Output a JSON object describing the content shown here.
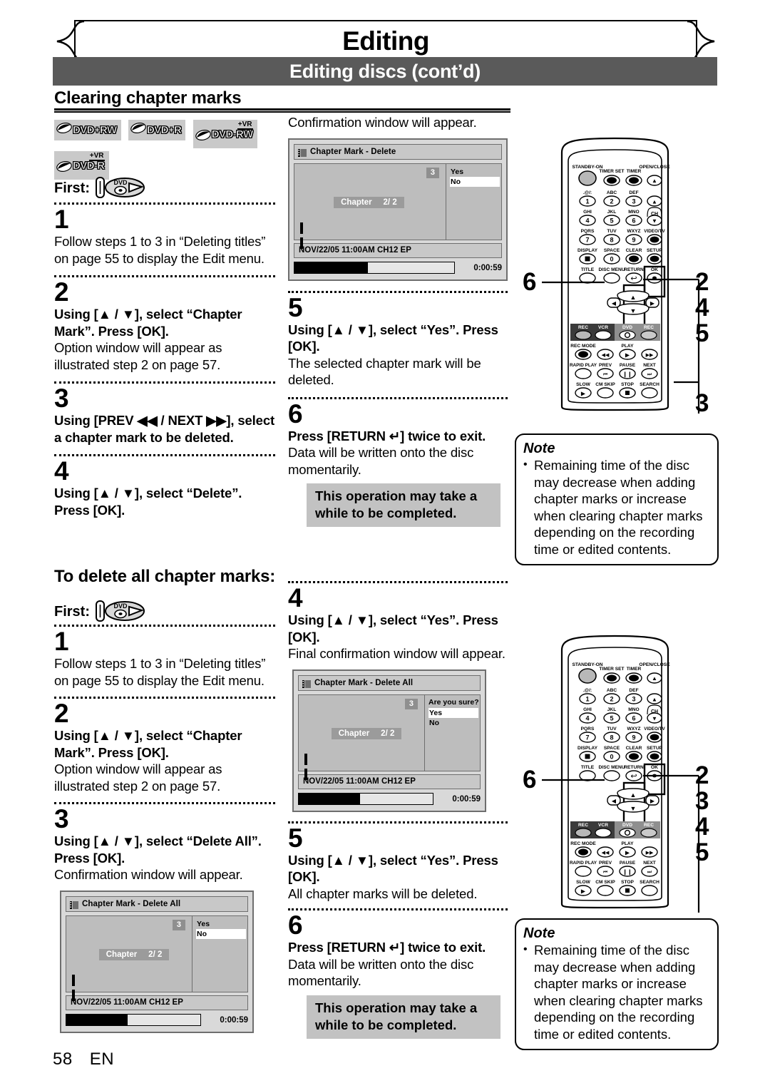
{
  "header": {
    "chapter_title": "Editing",
    "subhead": "Editing discs (cont’d)",
    "section_title": "Clearing chapter marks"
  },
  "disc_logos": [
    {
      "name": "DVD+RW",
      "vr": false
    },
    {
      "name": "DVD+R",
      "vr": false
    },
    {
      "name": "DVD-RW",
      "vr": true,
      "vr_tag": "+VR"
    },
    {
      "name": "DVD-R",
      "vr": true,
      "vr_tag": "+VR"
    }
  ],
  "first_label": "First:",
  "first_icon": "dvd-disc-insert-icon",
  "section1": {
    "steps": [
      {
        "num": "1",
        "bold": "",
        "normal": "Follow steps 1 to 3 in “Deleting titles” on page 55 to display the Edit menu."
      },
      {
        "num": "2",
        "bold": "Using [▲ / ▼], select “Chapter Mark”. Press [OK].",
        "normal": "Option window will appear as illustrated step 2 on page 57."
      },
      {
        "num": "3",
        "bold": "Using [PREV ◀◀ / NEXT ▶▶], select a chapter mark to be deleted.",
        "normal": ""
      },
      {
        "num": "4",
        "bold": "Using [▲ / ▼], select “Delete”. Press [OK].",
        "normal": ""
      }
    ],
    "mid_intro": "Confirmation window will appear.",
    "mid_steps": [
      {
        "num": "5",
        "bold": "Using [▲ / ▼], select “Yes”. Press [OK].",
        "normal": "The selected chapter mark will be deleted."
      },
      {
        "num": "6",
        "bold": "Press [RETURN ↵] twice to exit.",
        "normal": "Data will be written onto the disc momentarily."
      }
    ],
    "op_note_line1": "This operation may take a",
    "op_note_line2": "while to be completed."
  },
  "section2": {
    "title": "To delete all chapter marks:",
    "steps": [
      {
        "num": "1",
        "bold": "",
        "normal": "Follow steps 1 to 3 in “Deleting titles” on page 55 to display the Edit menu."
      },
      {
        "num": "2",
        "bold": "Using [▲ / ▼], select “Chapter Mark”. Press [OK].",
        "normal": "Option window will appear as illustrated step 2 on page 57."
      },
      {
        "num": "3",
        "bold": "Using [▲ / ▼], select “Delete All”. Press [OK].",
        "normal": "Confirmation window will appear."
      }
    ],
    "mid_steps": [
      {
        "num": "4",
        "bold": "Using [▲ / ▼], select “Yes”. Press [OK].",
        "normal": "Final confirmation window will appear."
      },
      {
        "num": "5",
        "bold": "Using [▲ / ▼], select “Yes”. Press [OK].",
        "normal": "All chapter marks will be deleted."
      },
      {
        "num": "6",
        "bold": "Press [RETURN ↵] twice to exit.",
        "normal": "Data will be written onto the disc momentarily."
      }
    ],
    "op_note_line1": "This operation may take a",
    "op_note_line2": "while to be completed."
  },
  "screens": {
    "delete": {
      "title": "Chapter Mark  -  Delete",
      "badge": "3",
      "chapter_label": "Chapter     2/ 2",
      "question": "",
      "options": [
        {
          "label": "Yes",
          "selected": false
        },
        {
          "label": "No",
          "selected": true
        }
      ],
      "info": "NOV/22/05 11:00AM CH12 EP",
      "time": "0:00:59"
    },
    "delete_all_confirm": {
      "title": "Chapter Mark  -  Delete All",
      "badge": "3",
      "chapter_label": "Chapter     2/ 2",
      "question": "",
      "options": [
        {
          "label": "Yes",
          "selected": false
        },
        {
          "label": "No",
          "selected": true
        }
      ],
      "info": "NOV/22/05 11:00AM CH12 EP",
      "time": "0:00:59"
    },
    "delete_all_sure": {
      "title": "Chapter Mark  -  Delete All",
      "badge": "3",
      "chapter_label": "Chapter     2/ 2",
      "question": "Are you sure?",
      "options": [
        {
          "label": "Yes",
          "selected": true
        },
        {
          "label": "No",
          "selected": false
        }
      ],
      "info": "NOV/22/05 11:00AM CH12 EP",
      "time": "0:00:59"
    }
  },
  "note": {
    "title": "Note",
    "bullet": "Remaining time of the disc may decrease when adding chapter marks or increase when clearing chapter marks depending on the recording time or edited contents."
  },
  "remote": {
    "labels": {
      "standby": "STANDBY-ON",
      "timer_set": "TIMER SET",
      "timer": "TIMER",
      "open_close": "OPEN/CLOSE",
      "k1": ".@/:",
      "k2": "ABC",
      "k3": "DEF",
      "k4": "GHI",
      "k5": "JKL",
      "k6": "MNO",
      "k7": "PQRS",
      "k8": "TUV",
      "k9": "WXYZ",
      "ch": "CH",
      "video_tv": "VIDEO/TV",
      "display": "DISPLAY",
      "space": "SPACE",
      "clear": "CLEAR",
      "setup": "SETUP",
      "title": "TITLE",
      "disc_menu": "DISC MENU",
      "return": "RETURN",
      "ok": "OK",
      "rec_left": "REC",
      "vcr": "VCR",
      "dvd": "DVD",
      "rec_right": "REC",
      "rec_mode": "REC MODE",
      "play": "PLAY",
      "rapid_play": "RAPID PLAY",
      "prev": "PREV",
      "pause": "PAUSE",
      "next": "NEXT",
      "slow": "SLOW",
      "cm_skip": "CM SKIP",
      "stop": "STOP",
      "search": "SEARCH",
      "n1": "1",
      "n2": "2",
      "n3": "3",
      "n4": "4",
      "n5": "5",
      "n6": "6",
      "n7": "7",
      "n8": "8",
      "n9": "9",
      "n0": "0"
    },
    "top_callouts_right": [
      "2",
      "4",
      "5"
    ],
    "top_callout_bottom_right": "3",
    "top_callout_left": "6",
    "bottom_callouts_right": [
      "2",
      "3",
      "4",
      "5"
    ],
    "bottom_callout_left": "6"
  },
  "footer": {
    "page": "58",
    "lang": "EN"
  }
}
